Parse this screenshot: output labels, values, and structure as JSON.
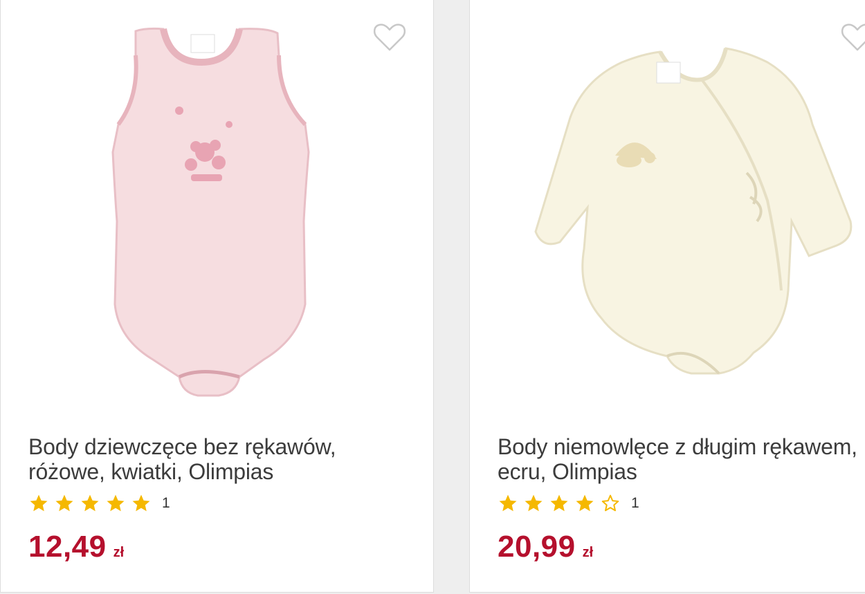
{
  "products": [
    {
      "title": "Body dziewczęce bez rękawów, różowe, kwiatki, Olimpias",
      "rating": 5,
      "rating_max": 5,
      "rating_count": "1",
      "price": "12,49",
      "currency": "zł",
      "image_color": "#f6dde0"
    },
    {
      "title": "Body niemowlęce z długim rękawem, ecru, Olimpias",
      "rating": 4,
      "rating_max": 5,
      "rating_count": "1",
      "price": "20,99",
      "currency": "zł",
      "image_color": "#f8f4e2"
    }
  ],
  "colors": {
    "price": "#b5102d",
    "star": "#f5b800",
    "title": "#3c3c3c"
  },
  "icons": {
    "wishlist": "heart-outline-icon",
    "star_filled": "star-filled-icon",
    "star_empty": "star-outline-icon"
  }
}
